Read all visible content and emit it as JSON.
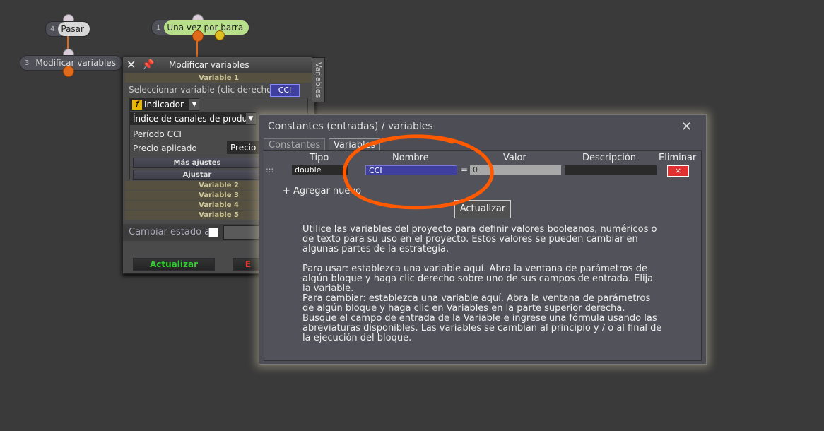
{
  "graph": {
    "nodes": [
      {
        "num": "4",
        "label": "Pasar"
      },
      {
        "num": "1",
        "label": "Una vez por barra"
      },
      {
        "num": "3",
        "label": "Modificar variables"
      }
    ]
  },
  "back_panel": {
    "title": "Modificar variables",
    "side_tab": "Variables",
    "variable1_header": "Variable 1",
    "select_label": "Seleccionar variable (clic derecho)",
    "select_value": "CCI",
    "indicator_label": "Indicador",
    "indicator_icon": "f",
    "channel_select": "Índice de canales de produ",
    "period_label": "Período CCI",
    "price_label": "Precio aplicado",
    "price_value": "Precio c",
    "more_settings": "Más ajustes",
    "adjust": "Ajustar",
    "variables": [
      "Variable 2",
      "Variable 3",
      "Variable 4",
      "Variable 5"
    ],
    "change_state": "Cambiar estado a",
    "update_button": "Actualizar",
    "other_button": "E"
  },
  "dialog": {
    "title": "Constantes (entradas) / variables",
    "tabs": [
      "Constantes",
      "Variables"
    ],
    "columns": [
      "Tipo",
      "Nombre",
      "Valor",
      "Descripción",
      "Eliminar"
    ],
    "row": {
      "drag": ":::",
      "type": "double",
      "name": "CCI",
      "equals": "=",
      "value": "0",
      "description": "",
      "delete": "×"
    },
    "add_new": "+ Agregar nuevo",
    "update_button": "Actualizar",
    "help": {
      "p1": [
        "Utilice las variables del proyecto para definir valores booleanos, numéricos o",
        "de texto para su uso en el proyecto. Estos valores se pueden cambiar en",
        "algunas partes de la estrategia."
      ],
      "p2": [
        "Para usar: establezca una variable aquí. Abra la ventana de parámetros de",
        "algún bloque y haga clic derecho sobre uno de sus campos de entrada. Elija",
        "la variable.",
        "Para cambiar: establezca una variable aquí. Abra la ventana de parámetros",
        "de algún bloque y haga clic en Variables en la parte superior derecha.",
        "Busque el campo de entrada de la Variable e ingrese una fórmula usando las",
        "abreviaturas disponibles. Las variables se cambian al principio y / o al final de",
        "la ejecución del bloque."
      ]
    }
  },
  "colors": {
    "accent_orange": "#ff5a00",
    "name_field": "#3f3fa0",
    "delete_red": "#e03030",
    "green_label": "#b8e08a"
  }
}
